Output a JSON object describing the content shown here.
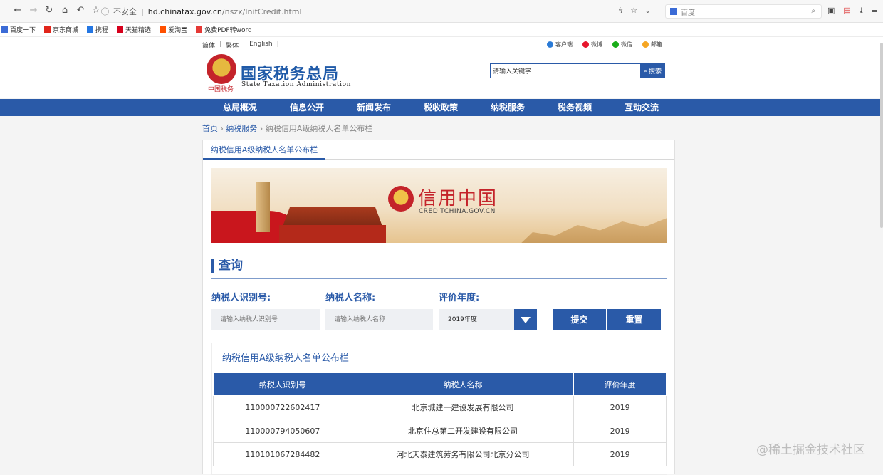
{
  "browser": {
    "security": "不安全",
    "url_host": "hd.chinatax.gov.cn",
    "url_path": "/nszx/InitCredit.html",
    "search_engine": "百度"
  },
  "bookmarks": [
    {
      "label": "百度一下",
      "color": "#3b6bd6"
    },
    {
      "label": "京东商城",
      "color": "#e1251b"
    },
    {
      "label": "携程",
      "color": "#2577e3"
    },
    {
      "label": "天猫精选",
      "color": "#d6001c"
    },
    {
      "label": "爱淘宝",
      "color": "#ff5000"
    },
    {
      "label": "免费PDF转word",
      "color": "#e53935"
    }
  ],
  "site": {
    "lang": {
      "simplified": "简体",
      "traditional": "繁体",
      "english": "English"
    },
    "social": [
      {
        "label": "客户端",
        "color": "#2a7ad6"
      },
      {
        "label": "微博",
        "color": "#e6162d"
      },
      {
        "label": "微信",
        "color": "#1aad19"
      },
      {
        "label": "邮箱",
        "color": "#f5a623"
      }
    ],
    "emblem_caption": "中国税务",
    "title_cn": "国家税务总局",
    "title_en": "State Taxation Administration",
    "search_placeholder": "请输入关键字",
    "search_button": "搜索"
  },
  "nav": [
    "总局概况",
    "信息公开",
    "新闻发布",
    "税收政策",
    "纳税服务",
    "税务视频",
    "互动交流"
  ],
  "breadcrumb": {
    "home": "首页",
    "section": "纳税服务",
    "current": "纳税信用A级纳税人名单公布栏"
  },
  "panel": {
    "tab": "纳税信用A级纳税人名单公布栏",
    "banner_title": "信用中国",
    "banner_sub": "CREDITCHINA.GOV.CN"
  },
  "query": {
    "title": "查询",
    "id_label": "纳税人识别号:",
    "id_placeholder": "请输入纳税人识别号",
    "name_label": "纳税人名称:",
    "name_placeholder": "请输入纳税人名称",
    "year_label": "评价年度:",
    "year_value": "2019年度",
    "submit": "提交",
    "reset": "重置"
  },
  "results": {
    "title": "纳税信用A级纳税人名单公布栏",
    "headers": [
      "纳税人识别号",
      "纳税人名称",
      "评价年度"
    ],
    "rows": [
      [
        "110000722602417",
        "北京城建一建设发展有限公司",
        "2019"
      ],
      [
        "110000794050607",
        "北京住总第二开发建设有限公司",
        "2019"
      ],
      [
        "110101067284482",
        "河北天泰建筑劳务有限公司北京分公司",
        "2019"
      ]
    ]
  },
  "watermark": "@稀土掘金技术社区"
}
